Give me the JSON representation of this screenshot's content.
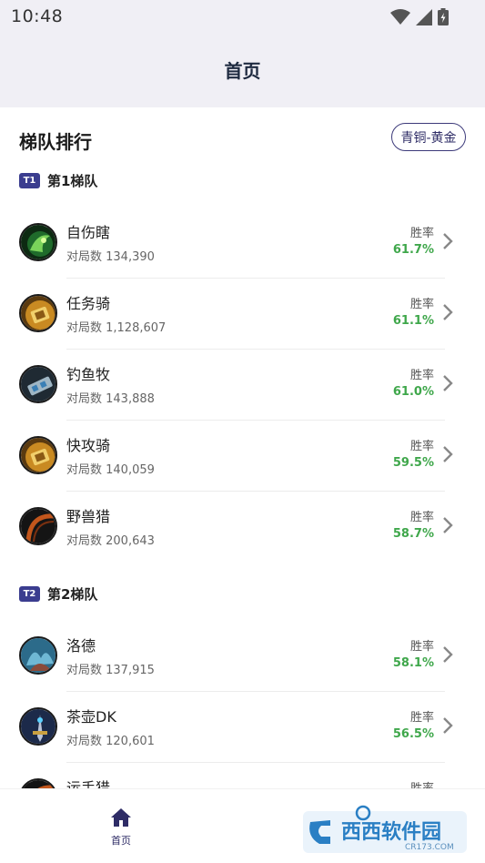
{
  "status_bar": {
    "time": "10:48",
    "icons": [
      "wifi-icon",
      "signal-icon",
      "battery-icon"
    ]
  },
  "app_bar": {
    "title": "首页"
  },
  "ladder": {
    "title": "梯队排行",
    "rank_range": "青铜-黄金",
    "tiers": [
      {
        "badge": "T1",
        "label": "第1梯队",
        "decks": [
          {
            "name": "自伤瞎",
            "games": "对局数 134,390",
            "winrate_label": "胜率",
            "winrate": "61.7%",
            "icon": "warlock-deck-icon"
          },
          {
            "name": "任务骑",
            "games": "对局数 1,128,607",
            "winrate_label": "胜率",
            "winrate": "61.1%",
            "icon": "paladin-quest-icon"
          },
          {
            "name": "钓鱼牧",
            "games": "对局数 143,888",
            "winrate_label": "胜率",
            "winrate": "61.0%",
            "icon": "priest-deck-icon"
          },
          {
            "name": "快攻骑",
            "games": "对局数 140,059",
            "winrate_label": "胜率",
            "winrate": "59.5%",
            "icon": "paladin-aggro-icon"
          },
          {
            "name": "野兽猎",
            "games": "对局数 200,643",
            "winrate_label": "胜率",
            "winrate": "58.7%",
            "icon": "hunter-deck-icon"
          }
        ]
      },
      {
        "badge": "T2",
        "label": "第2梯队",
        "decks": [
          {
            "name": "洛德",
            "games": "对局数 137,915",
            "winrate_label": "胜率",
            "winrate": "58.1%",
            "icon": "druid-deck-icon"
          },
          {
            "name": "茶壶DK",
            "games": "对局数 120,601",
            "winrate_label": "胜率",
            "winrate": "56.5%",
            "icon": "death-knight-deck-icon"
          },
          {
            "name": "运手猎",
            "games": "",
            "winrate_label": "胜率",
            "winrate": "",
            "icon": "hunter-deck-icon"
          }
        ]
      }
    ]
  },
  "bottom_nav": {
    "home_label": "首页"
  },
  "watermark": {
    "text": "西西软件园",
    "sub": "CR173.COM"
  }
}
